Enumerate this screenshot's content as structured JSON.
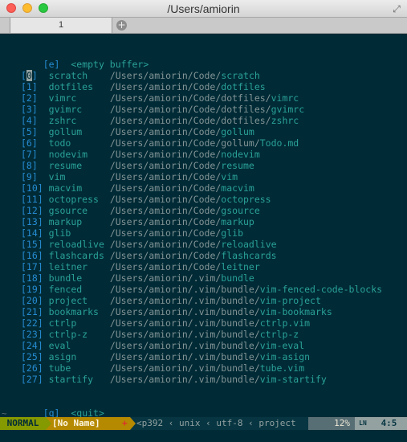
{
  "window": {
    "title": "/Users/amiorin"
  },
  "tabbar": {
    "tabs": [
      {
        "label": "1"
      }
    ]
  },
  "startify": {
    "empty_key": "[e]",
    "empty_label": "<empty buffer>",
    "entries": [
      {
        "key": "[0]",
        "name": "scratch",
        "dir": "/Users/amiorin/Code/",
        "leaf": "scratch"
      },
      {
        "key": "[1]",
        "name": "dotfiles",
        "dir": "/Users/amiorin/Code/",
        "leaf": "dotfiles"
      },
      {
        "key": "[2]",
        "name": "vimrc",
        "dir": "/Users/amiorin/Code/dotfiles/",
        "leaf": "vimrc"
      },
      {
        "key": "[3]",
        "name": "gvimrc",
        "dir": "/Users/amiorin/Code/dotfiles/",
        "leaf": "gvimrc"
      },
      {
        "key": "[4]",
        "name": "zshrc",
        "dir": "/Users/amiorin/Code/dotfiles/",
        "leaf": "zshrc"
      },
      {
        "key": "[5]",
        "name": "gollum",
        "dir": "/Users/amiorin/Code/",
        "leaf": "gollum"
      },
      {
        "key": "[6]",
        "name": "todo",
        "dir": "/Users/amiorin/Code/gollum/",
        "leaf": "Todo.md"
      },
      {
        "key": "[7]",
        "name": "nodevim",
        "dir": "/Users/amiorin/Code/",
        "leaf": "nodevim"
      },
      {
        "key": "[8]",
        "name": "resume",
        "dir": "/Users/amiorin/Code/",
        "leaf": "resume"
      },
      {
        "key": "[9]",
        "name": "vim",
        "dir": "/Users/amiorin/Code/",
        "leaf": "vim"
      },
      {
        "key": "[10]",
        "name": "macvim",
        "dir": "/Users/amiorin/Code/",
        "leaf": "macvim"
      },
      {
        "key": "[11]",
        "name": "octopress",
        "dir": "/Users/amiorin/Code/",
        "leaf": "octopress"
      },
      {
        "key": "[12]",
        "name": "gsource",
        "dir": "/Users/amiorin/Code/",
        "leaf": "gsource"
      },
      {
        "key": "[13]",
        "name": "markup",
        "dir": "/Users/amiorin/Code/",
        "leaf": "markup"
      },
      {
        "key": "[14]",
        "name": "glib",
        "dir": "/Users/amiorin/Code/",
        "leaf": "glib"
      },
      {
        "key": "[15]",
        "name": "reloadlive",
        "dir": "/Users/amiorin/Code/",
        "leaf": "reloadlive"
      },
      {
        "key": "[16]",
        "name": "flashcards",
        "dir": "/Users/amiorin/Code/",
        "leaf": "flashcards"
      },
      {
        "key": "[17]",
        "name": "leitner",
        "dir": "/Users/amiorin/Code/",
        "leaf": "leitner"
      },
      {
        "key": "[18]",
        "name": "bundle",
        "dir": "/Users/amiorin/.vim/",
        "leaf": "bundle"
      },
      {
        "key": "[19]",
        "name": "fenced",
        "dir": "/Users/amiorin/.vim/bundle/",
        "leaf": "vim-fenced-code-blocks"
      },
      {
        "key": "[20]",
        "name": "project",
        "dir": "/Users/amiorin/.vim/bundle/",
        "leaf": "vim-project"
      },
      {
        "key": "[21]",
        "name": "bookmarks",
        "dir": "/Users/amiorin/.vim/bundle/",
        "leaf": "vim-bookmarks"
      },
      {
        "key": "[22]",
        "name": "ctrlp",
        "dir": "/Users/amiorin/.vim/bundle/",
        "leaf": "ctrlp.vim"
      },
      {
        "key": "[23]",
        "name": "ctrlp-z",
        "dir": "/Users/amiorin/.vim/bundle/",
        "leaf": "ctrlp-z"
      },
      {
        "key": "[24]",
        "name": "eval",
        "dir": "/Users/amiorin/.vim/bundle/",
        "leaf": "vim-eval"
      },
      {
        "key": "[25]",
        "name": "asign",
        "dir": "/Users/amiorin/.vim/bundle/",
        "leaf": "vim-asign"
      },
      {
        "key": "[26]",
        "name": "tube",
        "dir": "/Users/amiorin/.vim/bundle/",
        "leaf": "tube.vim"
      },
      {
        "key": "[27]",
        "name": "startify",
        "dir": "/Users/amiorin/.vim/bundle/",
        "leaf": "vim-startify"
      }
    ],
    "quit_key": "[q]",
    "quit_label": "<quit>",
    "tilde": "~"
  },
  "statusline": {
    "mode": "NORMAL",
    "buffer": "[No Name]",
    "modified": "+",
    "info": "<p392 ‹ unix ‹ utf-8 ‹ project",
    "percent": "12%",
    "ln_icon": "LN",
    "position": "4:5"
  },
  "colors": {
    "background": "#002b36",
    "key": "#268bd2",
    "name": "#2aa198",
    "path": "#839496",
    "mode": "#859900",
    "buffer": "#b58900"
  }
}
